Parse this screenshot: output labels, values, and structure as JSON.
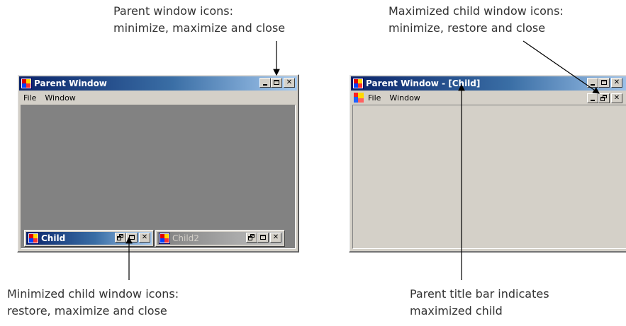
{
  "annotations": {
    "parent_icons": {
      "line1": "Parent window icons:",
      "line2": "minimize, maximize and close"
    },
    "max_child_icons": {
      "line1": "Maximized child window icons:",
      "line2": "minimize, restore and close"
    },
    "min_child_icons": {
      "line1": "Minimized child window icons:",
      "line2": "restore, maximize and close"
    },
    "parent_title": {
      "line1": "Parent title bar indicates",
      "line2": "maximized child"
    }
  },
  "left_window": {
    "title": "Parent Window",
    "menu": [
      "File",
      "Window"
    ],
    "client_color": "#828282",
    "minimized_children": [
      {
        "title": "Child",
        "active": true
      },
      {
        "title": "Child2",
        "active": false
      }
    ]
  },
  "right_window": {
    "title": "Parent Window - [Child]",
    "menu": [
      "File",
      "Window"
    ],
    "client_color": "#d4d0c8"
  },
  "colors": {
    "title_active_start": "#0a246a",
    "title_active_end": "#a6caf0",
    "face": "#d4d0c8"
  }
}
